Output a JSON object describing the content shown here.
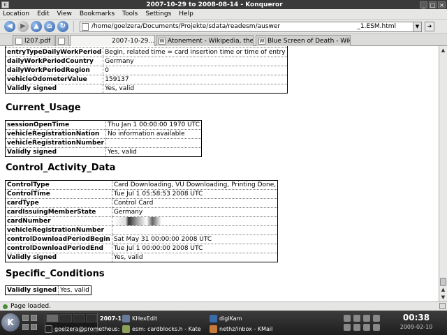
{
  "window": {
    "title": "2007-10-29 to 2008-08-14 - Konqueror"
  },
  "menu": [
    "Location",
    "Edit",
    "View",
    "Bookmarks",
    "Tools",
    "Settings",
    "Help"
  ],
  "toolbar": {
    "url": "/home/goelzera/Documents/Projekte/sdata/readesm/auswertung/D_",
    "url_tail": "_1.ESM.html"
  },
  "tabs": [
    {
      "label": "l207.pdf"
    },
    {
      "label": "2007-10-29..."
    },
    {
      "label": "Atonement - Wikipedia, the ..."
    },
    {
      "label": "Blue Screen of Death - Wiki..."
    }
  ],
  "top_table": {
    "rows": [
      {
        "key": "entryTypeDailyWorkPeriod",
        "value": "Begin, related time = card insertion time or time of entry"
      },
      {
        "key": "dailyWorkPeriodCountry",
        "value": "Germany"
      },
      {
        "key": "dailyWorkPeriodRegion",
        "value": "0"
      },
      {
        "key": "vehicleOdometerValue",
        "value": "159137"
      },
      {
        "key": "Validly signed",
        "value": "Yes, valid"
      }
    ]
  },
  "current_usage": {
    "heading": "Current_Usage",
    "rows": [
      {
        "key": "sessionOpenTime",
        "value": "Thu Jan 1 00:00:00 1970 UTC"
      },
      {
        "key": "vehicleRegistrationNation",
        "value": "No information available"
      },
      {
        "key": "vehicleRegistrationNumber",
        "value": ""
      },
      {
        "key": "Validly signed",
        "value": "Yes, valid"
      }
    ]
  },
  "control_activity": {
    "heading": "Control_Activity_Data",
    "rows": [
      {
        "key": "ControlType",
        "value": "Card Downloading, VU Downloading, Printing Done,"
      },
      {
        "key": "ControlTime",
        "value": "Tue Jul 1 05:58:53 2008 UTC"
      },
      {
        "key": "cardType",
        "value": "Control Card"
      },
      {
        "key": "cardIssuingMemberState",
        "value": "Germany"
      },
      {
        "key": "cardNumber",
        "value": ""
      },
      {
        "key": "vehicleRegistrationNumber",
        "value": ""
      },
      {
        "key": "controlDownloadPeriodBegin",
        "value": "Sat May 31 00:00:00 2008 UTC"
      },
      {
        "key": "controlDownloadPeriodEnd",
        "value": "Tue Jul 1 00:00:00 2008 UTC"
      },
      {
        "key": "Validly signed",
        "value": "Yes, valid"
      }
    ]
  },
  "specific_conditions": {
    "heading": "Specific_Conditions",
    "rows": [
      {
        "key": "Validly signed",
        "value": "Yes, valid"
      }
    ]
  },
  "status": {
    "text": "Page loaded."
  },
  "taskbar": {
    "kmenu": "K",
    "pager_label": "2007-1",
    "tasks": [
      {
        "label": "KHexEdit"
      },
      {
        "label": "digiKam"
      },
      {
        "label": "goelzera@prometheus: ~"
      },
      {
        "label": "esm: cardblocks.h - Kate"
      },
      {
        "label": "nethz/inbox - KMail"
      }
    ],
    "clock_time": "00:38",
    "clock_date": "2009-02-10"
  }
}
